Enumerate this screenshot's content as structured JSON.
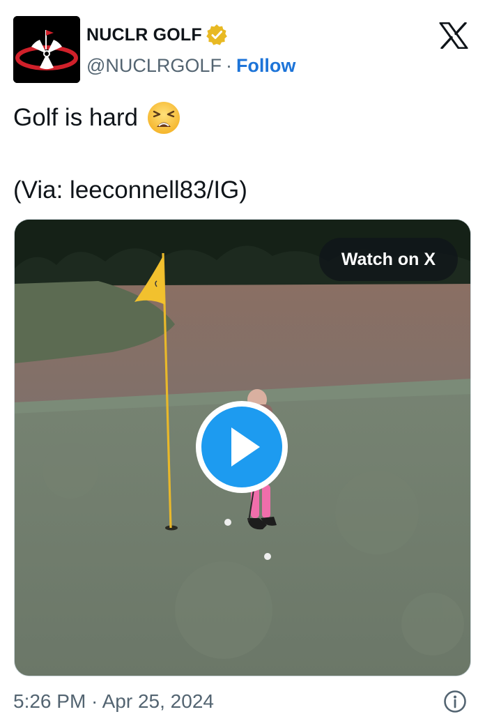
{
  "header": {
    "display_name": "NUCLR GOLF",
    "handle": "@NUCLRGOLF",
    "separator": "·",
    "follow_label": "Follow",
    "verified_color": "#e8b923"
  },
  "tweet": {
    "text_line1": "Golf is hard",
    "text_line2": "(Via: leeconnell83/IG)",
    "emoji": "tired-face-emoji"
  },
  "media": {
    "watch_label": "Watch on X",
    "play_button_color": "#1d9bf0",
    "flag_color": "#f2c12e"
  },
  "footer": {
    "timestamp": "5:26 PM · Apr 25, 2024"
  },
  "icons": {
    "brand": "x-logo-icon",
    "info": "info-icon",
    "badge": "verified-badge-icon"
  }
}
